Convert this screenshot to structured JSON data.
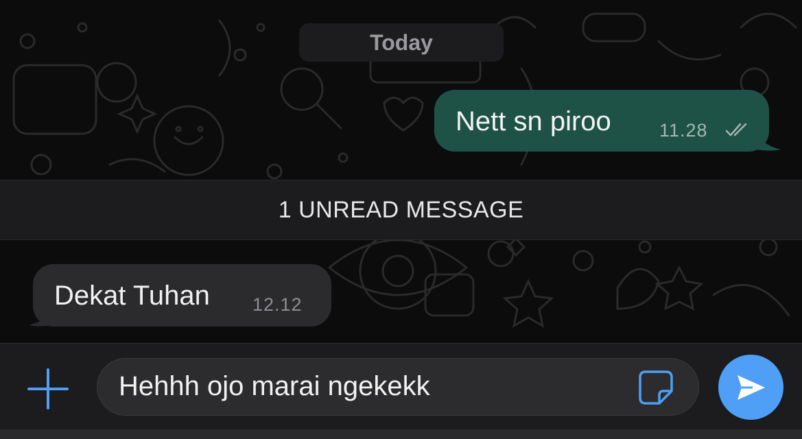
{
  "chat": {
    "date_separator": "Today",
    "messages": [
      {
        "direction": "outgoing",
        "text": "Nett sn piroo",
        "time": "11.28",
        "status": "read"
      },
      {
        "direction": "incoming",
        "text": "Dekat Tuhan",
        "time": "12.12"
      }
    ],
    "unread_banner": "1 UNREAD MESSAGE"
  },
  "composer": {
    "value": "Hehhh ojo marai ngekekk",
    "icons": {
      "attach": "plus-icon",
      "sticker": "sticker-icon",
      "send": "send-icon"
    }
  },
  "colors": {
    "outgoing_bubble": "#1f5246",
    "incoming_bubble": "#2b2b2d",
    "send_button": "#4e9ff5",
    "accent": "#4e9ff5"
  }
}
